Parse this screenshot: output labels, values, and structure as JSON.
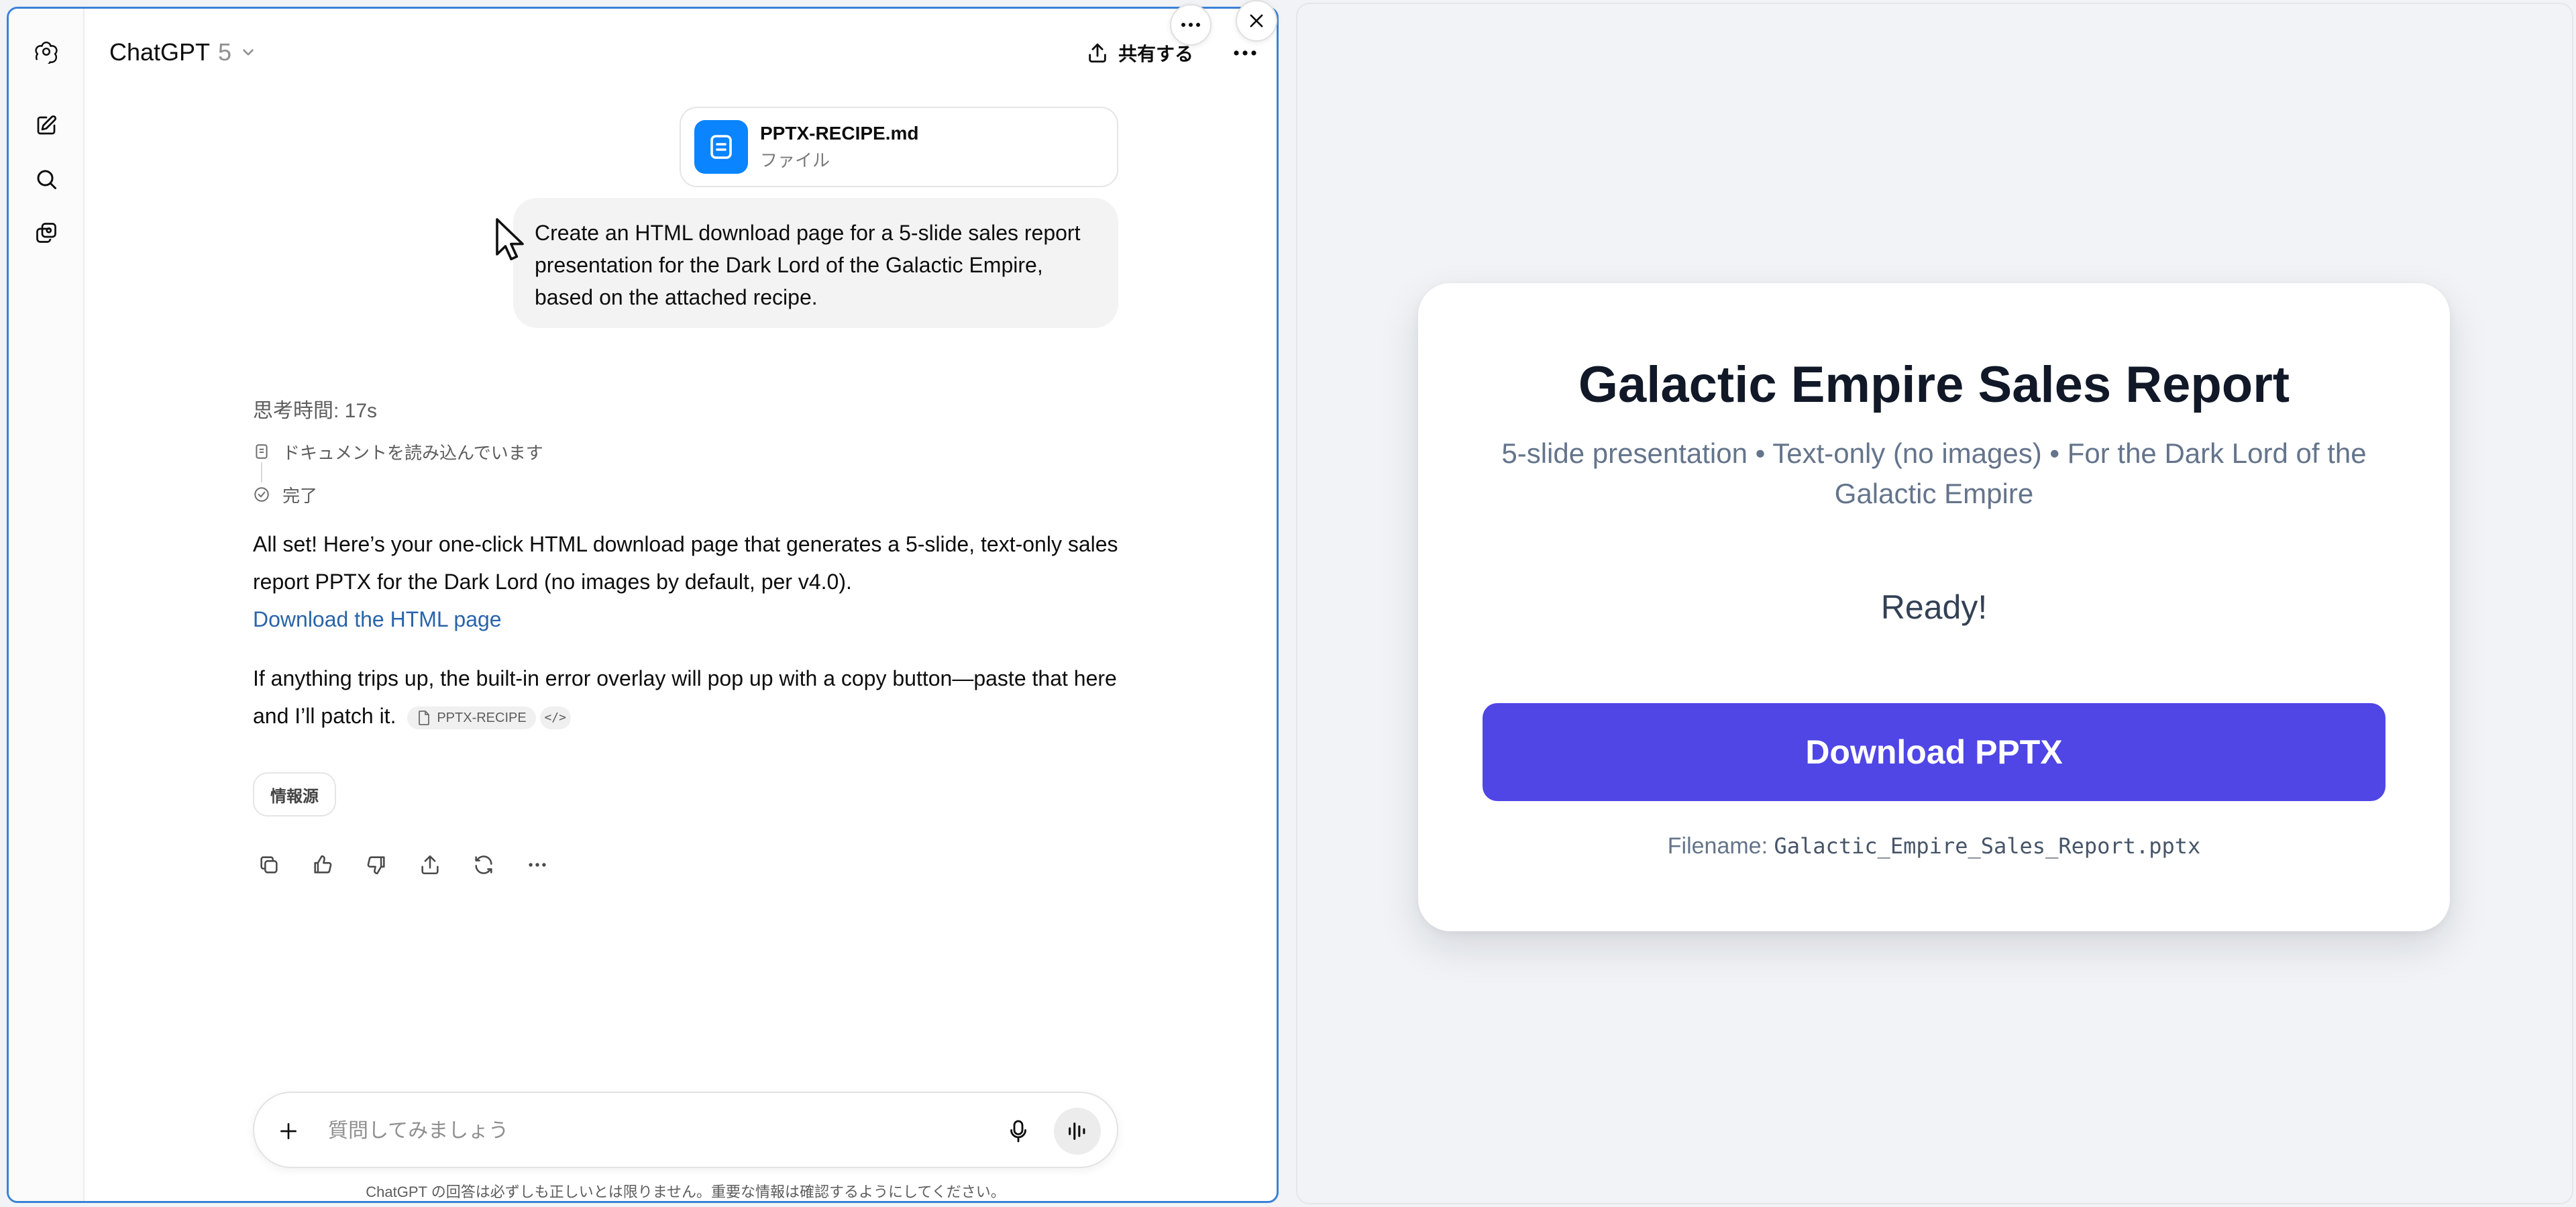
{
  "header": {
    "app_name": "ChatGPT",
    "model": "5",
    "share_label": "共有する"
  },
  "sidebar": {
    "items": [
      {
        "name": "logo",
        "icon": "openai-logo-icon"
      },
      {
        "name": "new-chat",
        "icon": "edit-icon"
      },
      {
        "name": "search",
        "icon": "search-icon"
      },
      {
        "name": "library",
        "icon": "images-icon"
      }
    ]
  },
  "conversation": {
    "attachment": {
      "filename": "PPTX-RECIPE.md",
      "type_label": "ファイル"
    },
    "user_message": "Create an HTML download page for a 5-slide sales report presentation for the Dark Lord of the Galactic Empire, based on the attached recipe.",
    "thinking_label": "思考時間: 17s",
    "steps": [
      "ドキュメントを読み込んでいます",
      "完了"
    ],
    "answer_p1": "All set! Here’s your one-click HTML download page that generates a 5-slide, text-only sales report PPTX for the Dark Lord (no images by default, per v4.0).",
    "answer_link": "Download the HTML page",
    "answer_p2": "If anything trips up, the built-in error overlay will pop up with a copy button—paste that here and I’ll patch it.",
    "citation_label": "PPTX-RECIPE",
    "citation_code": "</>",
    "sources_label": "情報源"
  },
  "composer": {
    "placeholder": "質問してみましょう",
    "disclaimer": "ChatGPT の回答は必ずしも正しいとは限りません。重要な情報は確認するようにしてください。"
  },
  "preview": {
    "title": "Galactic Empire Sales Report",
    "subtitle": "5-slide presentation • Text-only (no images) • For the Dark Lord of the Galactic Empire",
    "status": "Ready!",
    "button_label": "Download PPTX",
    "filename_label": "Filename:",
    "filename": "Galactic_Empire_Sales_Report.pptx"
  },
  "colors": {
    "accent_blue": "#3b82d6",
    "file_icon_bg": "#0a84ff",
    "link": "#2964aa",
    "download_button": "#4f46e5",
    "preview_bg": "#f1f3f6"
  }
}
